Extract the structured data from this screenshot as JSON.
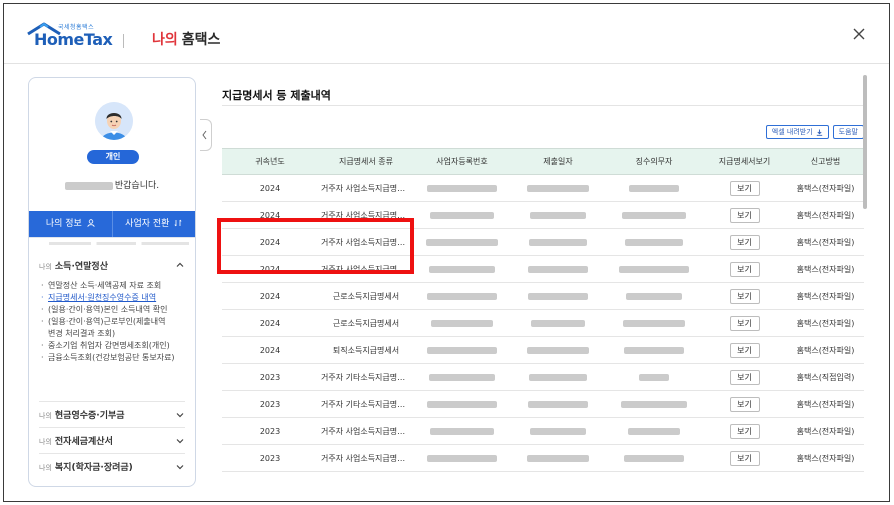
{
  "header": {
    "logo_small": "국세청홈택스",
    "logo_text": "HomeTax",
    "mine": "나의",
    "hometax": "홈택스"
  },
  "profile": {
    "badge": "개인",
    "greeting": "반갑습니다.",
    "my_info": "나의 정보",
    "switch_business": "사업자 전환"
  },
  "sidebar": {
    "section1": {
      "pre": "나의",
      "title": "소득·연말정산"
    },
    "sub_items": [
      {
        "label": "연말정산 소득·세액공제 자료 조회",
        "active": false
      },
      {
        "label": "지급명세서·원천징수영수증 내역",
        "active": true
      },
      {
        "label": "(일용·간이·용역)본인 소득내역 확인",
        "active": false
      },
      {
        "label": "(일용·간이·용역)근로부인(제출내역",
        "active": false
      },
      {
        "label": "변경 처리결과 조회)",
        "active": false,
        "continuation": true
      },
      {
        "label": "중소기업 취업자 감면명세조회(개인)",
        "active": false
      },
      {
        "label": "금융소득조회(건강보험공단 통보자료)",
        "active": false
      }
    ],
    "section2": {
      "pre": "나의",
      "title": "현금영수증·기부금"
    },
    "section3": {
      "pre": "나의",
      "title": "전자세금계산서"
    },
    "section4": {
      "pre": "나의",
      "title": "복지(학자금·장려금)"
    }
  },
  "main": {
    "title": "지급명세서 등 제출내역",
    "excel_label": "엑셀 내려받기",
    "help_label": "도움말",
    "columns": [
      "귀속년도",
      "지급명세서 종류",
      "사업자등록번호",
      "제출일자",
      "징수의무자",
      "지급명세서보기",
      "신고방법"
    ],
    "view_label": "보기",
    "rows": [
      {
        "year": "2024",
        "kind": "거주자 사업소득지급명세서",
        "method": "홈택스(전자파일)"
      },
      {
        "year": "2024",
        "kind": "거주자 사업소득지급명세서",
        "method": "홈택스(전자파일)"
      },
      {
        "year": "2024",
        "kind": "거주자 사업소득지급명세서",
        "method": "홈택스(전자파일)"
      },
      {
        "year": "2024",
        "kind": "거주자 사업소득지급명세서",
        "method": "홈택스(전자파일)"
      },
      {
        "year": "2024",
        "kind": "근로소득지급명세서",
        "method": "홈택스(전자파일)"
      },
      {
        "year": "2024",
        "kind": "근로소득지급명세서",
        "method": "홈택스(전자파일)"
      },
      {
        "year": "2024",
        "kind": "퇴직소득지급명세서",
        "method": "홈택스(전자파일)"
      },
      {
        "year": "2023",
        "kind": "거주자 기타소득지급명세서",
        "method": "홈택스(직접입력)"
      },
      {
        "year": "2023",
        "kind": "거주자 기타소득지급명세서",
        "method": "홈택스(전자파일)"
      },
      {
        "year": "2023",
        "kind": "거주자 사업소득지급명세서",
        "method": "홈택스(전자파일)"
      },
      {
        "year": "2023",
        "kind": "거주자 사업소득지급명세서",
        "method": "홈택스(전자파일)"
      }
    ]
  },
  "colors": {
    "brand_blue": "#2869d9",
    "mine_red": "#e0353b",
    "table_header": "#e6f4ee",
    "highlight_red": "#ee1111"
  },
  "icons": [
    "close-icon",
    "user-icon",
    "switch-icon",
    "chevron-up-icon",
    "chevron-down-icon",
    "download-icon",
    "collapse-left-icon"
  ]
}
